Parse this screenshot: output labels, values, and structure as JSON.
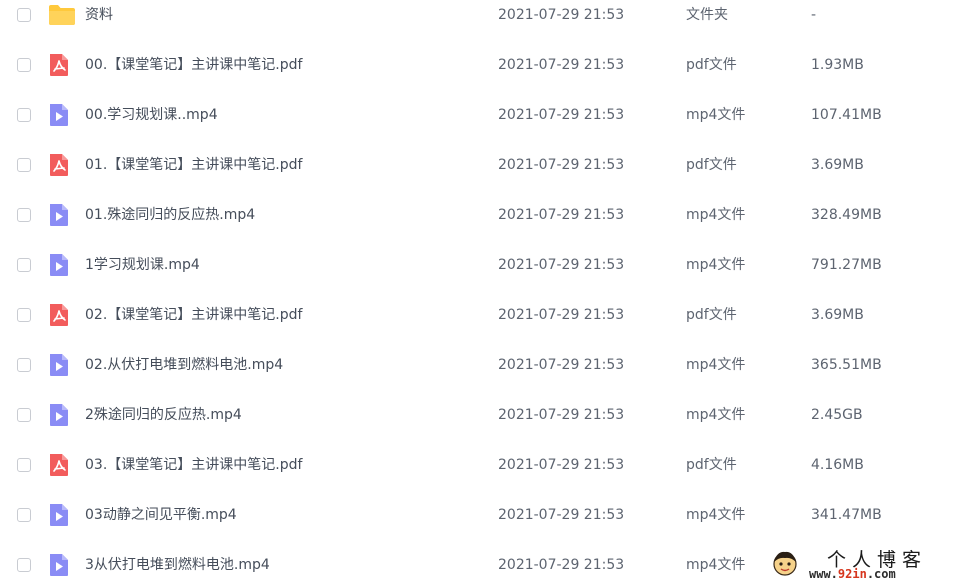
{
  "files": [
    {
      "name": "资料",
      "date": "2021-07-29 21:53",
      "type": "文件夹",
      "size": "-",
      "icon": "folder-icon"
    },
    {
      "name": "00.【课堂笔记】主讲课中笔记.pdf",
      "date": "2021-07-29 21:53",
      "type": "pdf文件",
      "size": "1.93MB",
      "icon": "pdf-icon"
    },
    {
      "name": "00.学习规划课..mp4",
      "date": "2021-07-29 21:53",
      "type": "mp4文件",
      "size": "107.41MB",
      "icon": "video-icon"
    },
    {
      "name": "01.【课堂笔记】主讲课中笔记.pdf",
      "date": "2021-07-29 21:53",
      "type": "pdf文件",
      "size": "3.69MB",
      "icon": "pdf-icon"
    },
    {
      "name": "01.殊途同归的反应热.mp4",
      "date": "2021-07-29 21:53",
      "type": "mp4文件",
      "size": "328.49MB",
      "icon": "video-icon"
    },
    {
      "name": "1学习规划课.mp4",
      "date": "2021-07-29 21:53",
      "type": "mp4文件",
      "size": "791.27MB",
      "icon": "video-icon"
    },
    {
      "name": "02.【课堂笔记】主讲课中笔记.pdf",
      "date": "2021-07-29 21:53",
      "type": "pdf文件",
      "size": "3.69MB",
      "icon": "pdf-icon"
    },
    {
      "name": "02.从伏打电堆到燃料电池.mp4",
      "date": "2021-07-29 21:53",
      "type": "mp4文件",
      "size": "365.51MB",
      "icon": "video-icon"
    },
    {
      "name": "2殊途同归的反应热.mp4",
      "date": "2021-07-29 21:53",
      "type": "mp4文件",
      "size": "2.45GB",
      "icon": "video-icon"
    },
    {
      "name": "03.【课堂笔记】主讲课中笔记.pdf",
      "date": "2021-07-29 21:53",
      "type": "pdf文件",
      "size": "4.16MB",
      "icon": "pdf-icon"
    },
    {
      "name": "03动静之间见平衡.mp4",
      "date": "2021-07-29 21:53",
      "type": "mp4文件",
      "size": "341.47MB",
      "icon": "video-icon"
    },
    {
      "name": "3从伏打电堆到燃料电池.mp4",
      "date": "2021-07-29 21:53",
      "type": "mp4文件",
      "size": "",
      "icon": "video-icon"
    }
  ],
  "watermark": {
    "title": "个人博客",
    "url_prefix": "www.",
    "url_accent": "92in",
    "url_suffix": ".com"
  },
  "colors": {
    "folder": "#ffc93c",
    "pdf": "#f25c5c",
    "video": "#8a8cf5"
  }
}
